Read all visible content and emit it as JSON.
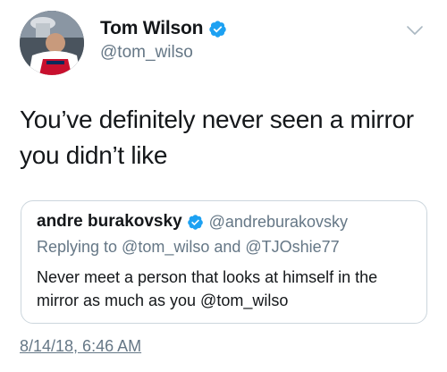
{
  "author": {
    "display_name": "Tom Wilson",
    "handle": "@tom_wilso",
    "verified": true,
    "avatar_icon": "user-avatar-with-trophy"
  },
  "menu": {
    "icon": "chevron-down-icon"
  },
  "tweet": {
    "text": "You’ve definitely never seen a mirror you didn’t like"
  },
  "quoted_tweet": {
    "display_name": "andre burakovsky",
    "handle": "@andreburakovsky",
    "verified": true,
    "replying_to": "Replying to @tom_wilso and @TJOshie77",
    "text": "Never meet a person that looks at himself in the mirror as much as you @tom_wilso"
  },
  "timestamp": "8/14/18, 6:46 AM",
  "colors": {
    "verified_blue": "#1da1f2",
    "secondary_text": "#657786",
    "primary_text": "#14171a",
    "card_border": "#ccd6dd"
  }
}
